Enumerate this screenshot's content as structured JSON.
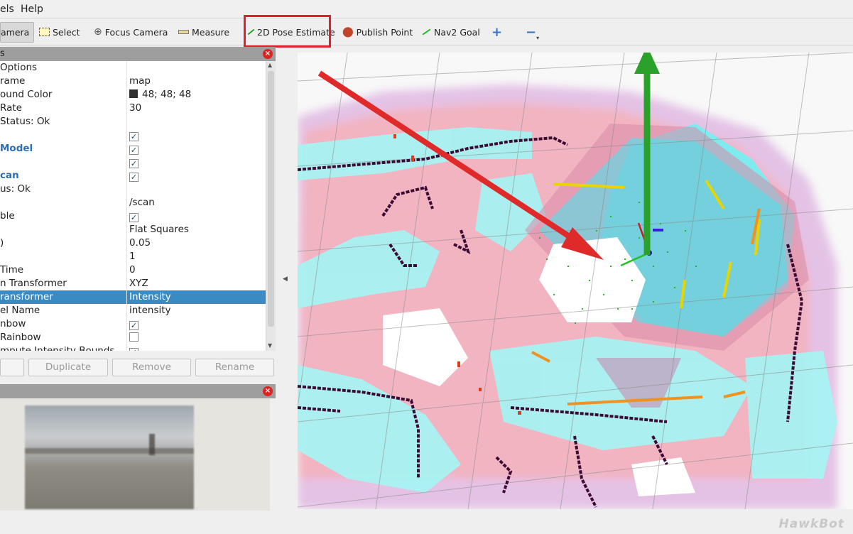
{
  "menubar": {
    "items": [
      "els",
      "Help"
    ]
  },
  "toolbar": {
    "interact_label": "amera",
    "select_label": "Select",
    "focus_camera_label": "Focus Camera",
    "measure_label": "Measure",
    "pose_estimate_label": "2D Pose Estimate",
    "publish_point_label": "Publish Point",
    "nav2_goal_label": "Nav2 Goal"
  },
  "displays": {
    "header": "s",
    "rows": [
      {
        "k": "Options",
        "v": ""
      },
      {
        "k": "rame",
        "v": "map"
      },
      {
        "k": "ound Color",
        "v": "48; 48; 48"
      },
      {
        "k": "Rate",
        "v": "30"
      },
      {
        "k": "Status: Ok",
        "v": ""
      },
      {
        "k": "",
        "v": ""
      },
      {
        "k": "Model",
        "v": ""
      },
      {
        "k": "",
        "v": ""
      },
      {
        "k": "can",
        "v": ""
      },
      {
        "k": "us: Ok",
        "v": ""
      },
      {
        "k": "",
        "v": "/scan"
      },
      {
        "k": "ble",
        "v": ""
      },
      {
        "k": "",
        "v": "Flat Squares"
      },
      {
        "k": ")",
        "v": "0.05"
      },
      {
        "k": "",
        "v": "1"
      },
      {
        "k": "Time",
        "v": "0"
      },
      {
        "k": "n Transformer",
        "v": "XYZ"
      },
      {
        "k": "ransformer",
        "v": "Intensity"
      },
      {
        "k": "el Name",
        "v": "intensity"
      },
      {
        "k": "nbow",
        "v": ""
      },
      {
        "k": "Rainbow",
        "v": ""
      },
      {
        "k": "mpute Intensity Bounds",
        "v": ""
      }
    ]
  },
  "panel_buttons": {
    "duplicate": "Duplicate",
    "remove": "Remove",
    "rename": "Rename"
  },
  "watermark": "HawkBot",
  "colors": {
    "highlight": "#e0202a",
    "selection": "#3a8ac4",
    "pose_arrow": "#2aa12a"
  }
}
